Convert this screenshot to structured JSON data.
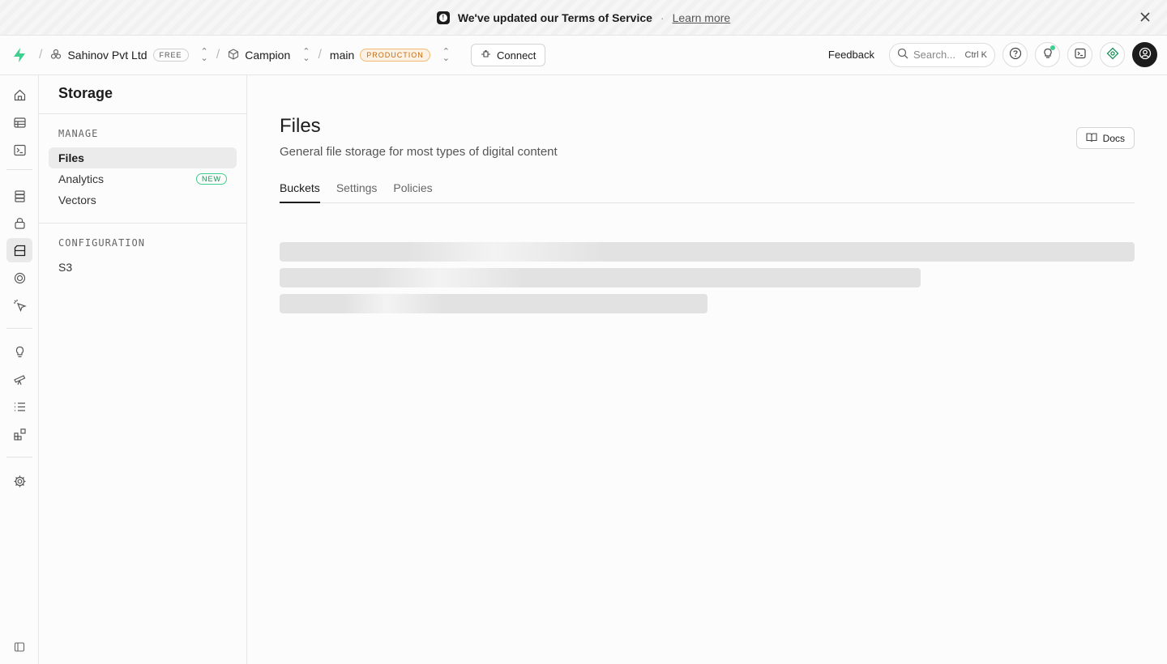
{
  "banner": {
    "message": "We've updated our Terms of Service",
    "separator": "·",
    "link": "Learn more"
  },
  "topbar": {
    "org_name": "Sahinov Pvt Ltd",
    "org_plan": "FREE",
    "project_name": "Campion",
    "branch_name": "main",
    "branch_env": "PRODUCTION",
    "connect_label": "Connect",
    "feedback_label": "Feedback",
    "search_placeholder": "Search...",
    "search_shortcut": "Ctrl K"
  },
  "sidebar": {
    "title": "Storage",
    "groups": [
      {
        "title": "MANAGE",
        "items": [
          {
            "label": "Files",
            "active": true
          },
          {
            "label": "Analytics",
            "badge": "NEW"
          },
          {
            "label": "Vectors"
          }
        ]
      },
      {
        "title": "CONFIGURATION",
        "items": [
          {
            "label": "S3"
          }
        ]
      }
    ]
  },
  "main": {
    "title": "Files",
    "subtitle": "General file storage for most types of digital content",
    "docs_label": "Docs",
    "tabs": [
      {
        "label": "Buckets",
        "active": true
      },
      {
        "label": "Settings"
      },
      {
        "label": "Policies"
      }
    ]
  },
  "colors": {
    "brand": "#3ecf8e",
    "production_badge": "#c46a11"
  }
}
